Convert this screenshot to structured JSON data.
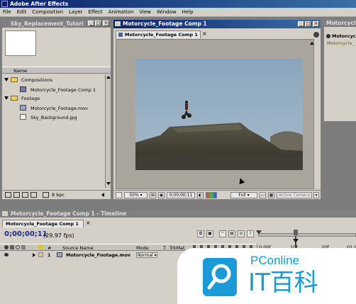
{
  "app_title": "Adobe After Effects",
  "menu": [
    "File",
    "Edit",
    "Composition",
    "Layer",
    "Effect",
    "Animation",
    "View",
    "Window",
    "Help"
  ],
  "project": {
    "title": "Sky_Replacement_Tutori",
    "column_name": "Name",
    "folders": [
      {
        "name": "Compositions",
        "items": [
          "Motorcycle_Footage Comp 1"
        ]
      },
      {
        "name": "Footage",
        "items": [
          "Motorcycle_Footage.mov",
          "Sky_Background.jpg"
        ]
      }
    ],
    "bpc": "8 bpc"
  },
  "comp": {
    "window_title": "Motorcycle_Footage Comp 1",
    "tab": "Motorcycle_Footage Comp 1",
    "zoom": "50%",
    "timecode": "0;00;00;11",
    "resolution": "Full",
    "camera": "Active Camera"
  },
  "right_panel": {
    "title": "Motorcycl",
    "item": "Motorcycle_Foo",
    "subitem": "Motorcycle_"
  },
  "timeline": {
    "window_title": "Motorcycle_Footage Comp 1 - Timeline",
    "tab": "Motorcycle_Footage Comp 1",
    "timecode": "0;00;00;11",
    "fps": "(29.97 fps)",
    "headers": {
      "num": "#",
      "source": "Source Name",
      "mode": "Mode",
      "t": "T",
      "trkmat": "TrkMat"
    },
    "layer": {
      "num": "1",
      "name": "Motorcycle_Footage.mov",
      "mode": "Normal"
    },
    "ruler": [
      "0:00f",
      "10f",
      "20f",
      "01:0"
    ]
  },
  "watermark": {
    "brand": "PConline",
    "logo_text": "IT百科"
  },
  "colors": {
    "title_active": "#0a246a",
    "title_inactive": "#808080",
    "panel": "#d4d0c8"
  }
}
